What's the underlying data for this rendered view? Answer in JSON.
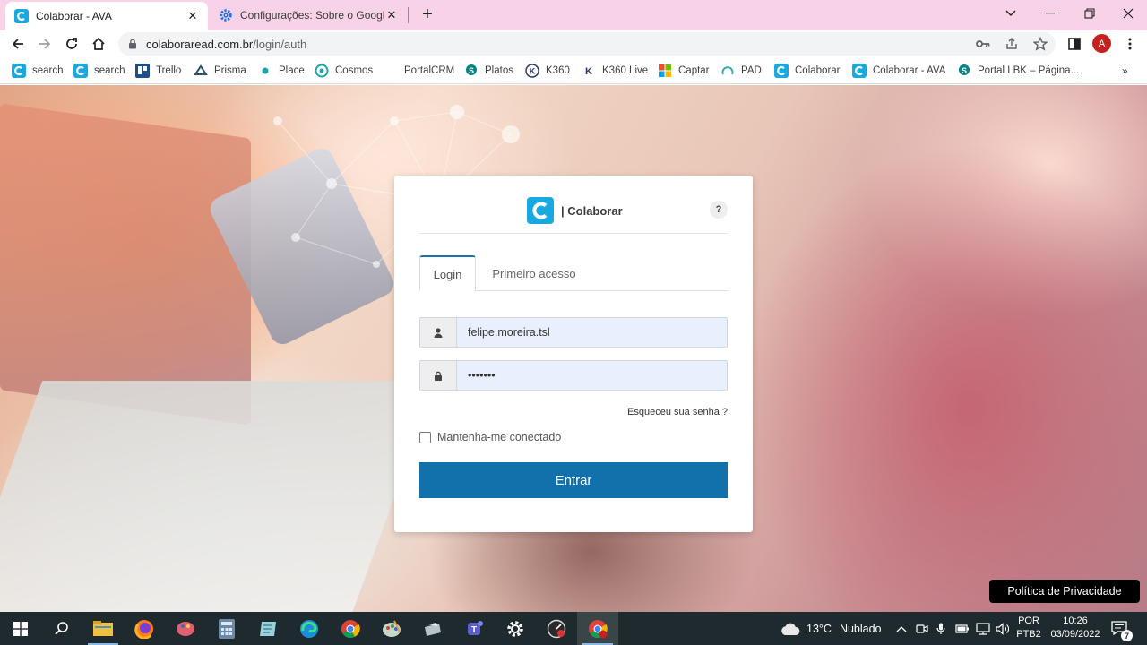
{
  "browser": {
    "tabs": [
      {
        "title": "Colaborar - AVA",
        "active": true
      },
      {
        "title": "Configurações: Sobre o Google C",
        "active": false
      }
    ],
    "new_tab": "+",
    "url_host": "colaboraread.com.br",
    "url_path": "/login/auth",
    "profile_initial": "A"
  },
  "bookmarks": [
    {
      "label": "search",
      "icon": "colaborar-icon"
    },
    {
      "label": "search",
      "icon": "colaborar-icon"
    },
    {
      "label": "Trello",
      "icon": "trello-icon"
    },
    {
      "label": "Prisma",
      "icon": "prisma-icon"
    },
    {
      "label": "Place",
      "icon": "place-icon"
    },
    {
      "label": "Cosmos",
      "icon": "cosmos-icon"
    },
    {
      "label": "PortalCRM",
      "icon": "portalcrm-icon"
    },
    {
      "label": "Platos",
      "icon": "sharepoint-icon"
    },
    {
      "label": "K360",
      "icon": "k360-icon"
    },
    {
      "label": "K360 Live",
      "icon": "k360-live-icon"
    },
    {
      "label": "Captar",
      "icon": "windows-icon"
    },
    {
      "label": "PAD",
      "icon": "pad-icon"
    },
    {
      "label": "Colaborar",
      "icon": "colaborar-icon"
    },
    {
      "label": "Colaborar - AVA",
      "icon": "colaborar-icon"
    },
    {
      "label": "Portal LBK – Página...",
      "icon": "sharepoint-icon"
    }
  ],
  "bookmarks_more": "»",
  "login": {
    "brand": "| Colaborar",
    "help": "?",
    "tab_login": "Login",
    "tab_first_access": "Primeiro acesso",
    "username": "felipe.moreira.tsl",
    "password": "•••••••",
    "forgot": "Esqueceu sua senha ?",
    "remember": "Mantenha-me conectado",
    "submit": "Entrar",
    "colors": {
      "primary": "#1270aa",
      "accent_tab": "#1b75ad"
    }
  },
  "privacy": "Política de Privacidade",
  "taskbar": {
    "weather_temp": "13°C",
    "weather_desc": "Nublado",
    "lang_top": "POR",
    "lang_bottom": "PTB2",
    "time": "10:26",
    "date": "03/09/2022",
    "notifications": "7"
  }
}
